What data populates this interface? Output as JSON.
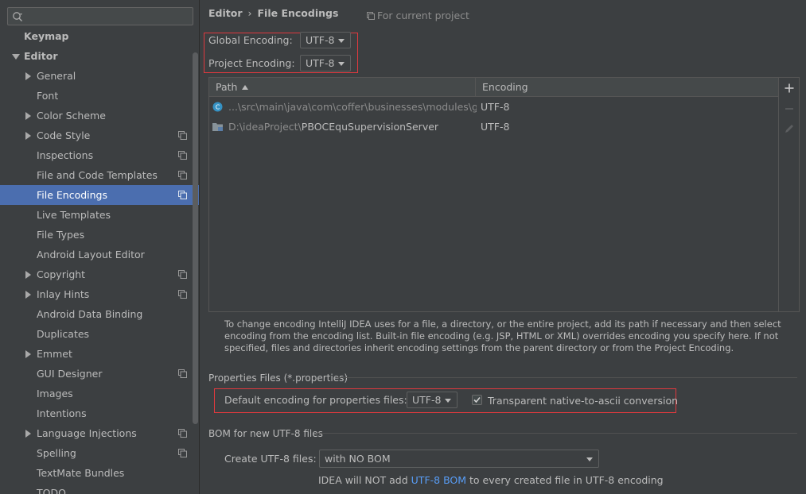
{
  "search": {
    "placeholder": ""
  },
  "sidebar": {
    "items": [
      {
        "label": "Keymap",
        "level": 0,
        "bold": true
      },
      {
        "label": "Editor",
        "level": 0,
        "bold": true,
        "expanded": true
      },
      {
        "label": "General",
        "level": 1,
        "expandable": true
      },
      {
        "label": "Font",
        "level": 1
      },
      {
        "label": "Color Scheme",
        "level": 1,
        "expandable": true
      },
      {
        "label": "Code Style",
        "level": 1,
        "expandable": true,
        "project": true
      },
      {
        "label": "Inspections",
        "level": 1,
        "project": true
      },
      {
        "label": "File and Code Templates",
        "level": 1,
        "project": true
      },
      {
        "label": "File Encodings",
        "level": 1,
        "project": true,
        "selected": true
      },
      {
        "label": "Live Templates",
        "level": 1
      },
      {
        "label": "File Types",
        "level": 1
      },
      {
        "label": "Android Layout Editor",
        "level": 1
      },
      {
        "label": "Copyright",
        "level": 1,
        "expandable": true,
        "project": true
      },
      {
        "label": "Inlay Hints",
        "level": 1,
        "expandable": true,
        "project": true
      },
      {
        "label": "Android Data Binding",
        "level": 1
      },
      {
        "label": "Duplicates",
        "level": 1
      },
      {
        "label": "Emmet",
        "level": 1,
        "expandable": true
      },
      {
        "label": "GUI Designer",
        "level": 1,
        "project": true
      },
      {
        "label": "Images",
        "level": 1
      },
      {
        "label": "Intentions",
        "level": 1
      },
      {
        "label": "Language Injections",
        "level": 1,
        "expandable": true,
        "project": true
      },
      {
        "label": "Spelling",
        "level": 1,
        "project": true
      },
      {
        "label": "TextMate Bundles",
        "level": 1
      },
      {
        "label": "TODO",
        "level": 1
      }
    ]
  },
  "header": {
    "crumb_parent": "Editor",
    "crumb_sep": "›",
    "crumb_current": "File Encodings",
    "for_current_project": "For current project"
  },
  "encoding": {
    "global_label": "Global Encoding:",
    "global_value": "UTF-8",
    "project_label": "Project Encoding:",
    "project_value": "UTF-8"
  },
  "table": {
    "col_path": "Path",
    "col_encoding": "Encoding",
    "rows": [
      {
        "path_dim": "...\\src\\main\\java\\com\\coffer\\businesses\\modules\\gzh",
        "path_main": "",
        "encoding": "UTF-8"
      },
      {
        "path_dim": "D:\\ideaProject\\",
        "path_main": "PBOCEquSupervisionServer",
        "encoding": "UTF-8"
      }
    ]
  },
  "description": "To change encoding IntelliJ IDEA uses for a file, a directory, or the entire project, add its path if necessary and then select encoding from the encoding list. Built-in file encoding (e.g. JSP, HTML or XML) overrides encoding you specify here. If not specified, files and directories inherit encoding settings from the parent directory or from the Project Encoding.",
  "properties": {
    "section_title": "Properties Files (*.properties)",
    "default_label": "Default encoding for properties files:",
    "default_value": "UTF-8",
    "transparent_label": "Transparent native-to-ascii conversion",
    "transparent_checked": true
  },
  "bom": {
    "section_title": "BOM for new UTF-8 files",
    "create_label": "Create UTF-8 files:",
    "create_value": "with NO BOM",
    "note_before": "IDEA will NOT add ",
    "note_link": "UTF-8 BOM",
    "note_after": " to every created file in UTF-8 encoding"
  },
  "colors": {
    "background": "#3c3f41",
    "selection": "#4b6eaf",
    "highlight_border": "#e0393e",
    "link": "#589df6"
  }
}
